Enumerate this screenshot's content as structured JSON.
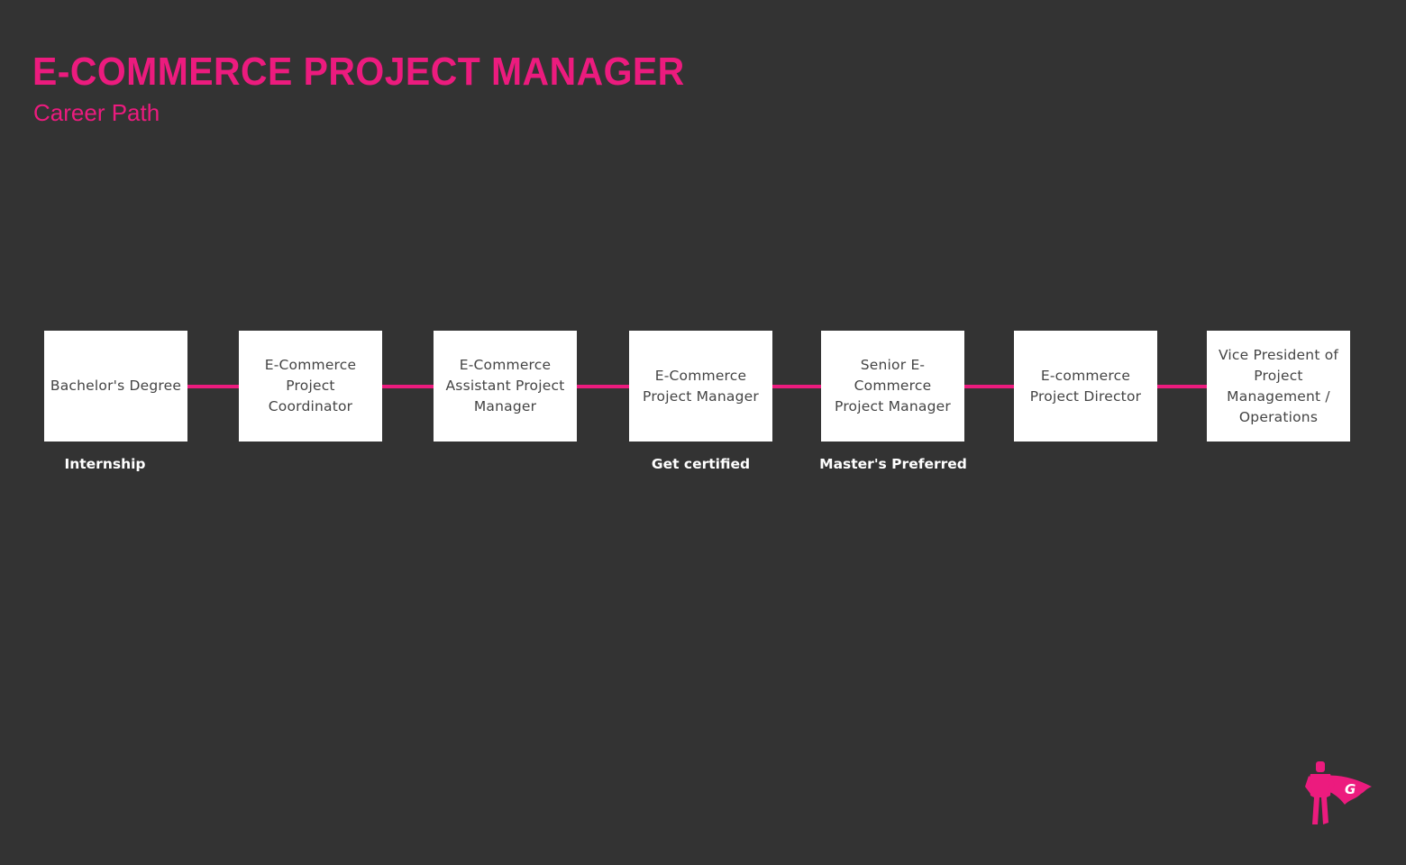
{
  "header": {
    "title": "E-COMMERCE PROJECT MANAGER",
    "subtitle": "Career Path"
  },
  "colors": {
    "background": "#333333",
    "accent": "#ec1b7e",
    "box": "#ffffff",
    "box_text": "#444444",
    "note_text": "#ffffff"
  },
  "steps": [
    {
      "label": "Bachelor's Degree",
      "note": "Internship"
    },
    {
      "label": "E-Commerce Project Coordinator",
      "note": ""
    },
    {
      "label": "E-Commerce Assistant Project Manager",
      "note": ""
    },
    {
      "label": "E-Commerce Project Manager",
      "note": "Get certified"
    },
    {
      "label": "Senior E-Commerce Project Manager",
      "note": "Master's Preferred"
    },
    {
      "label": "E-commerce Project Director",
      "note": ""
    },
    {
      "label": "Vice President of Project Management / Operations",
      "note": ""
    }
  ],
  "logo": {
    "icon": "superhero-cape-icon",
    "letter": "G"
  }
}
